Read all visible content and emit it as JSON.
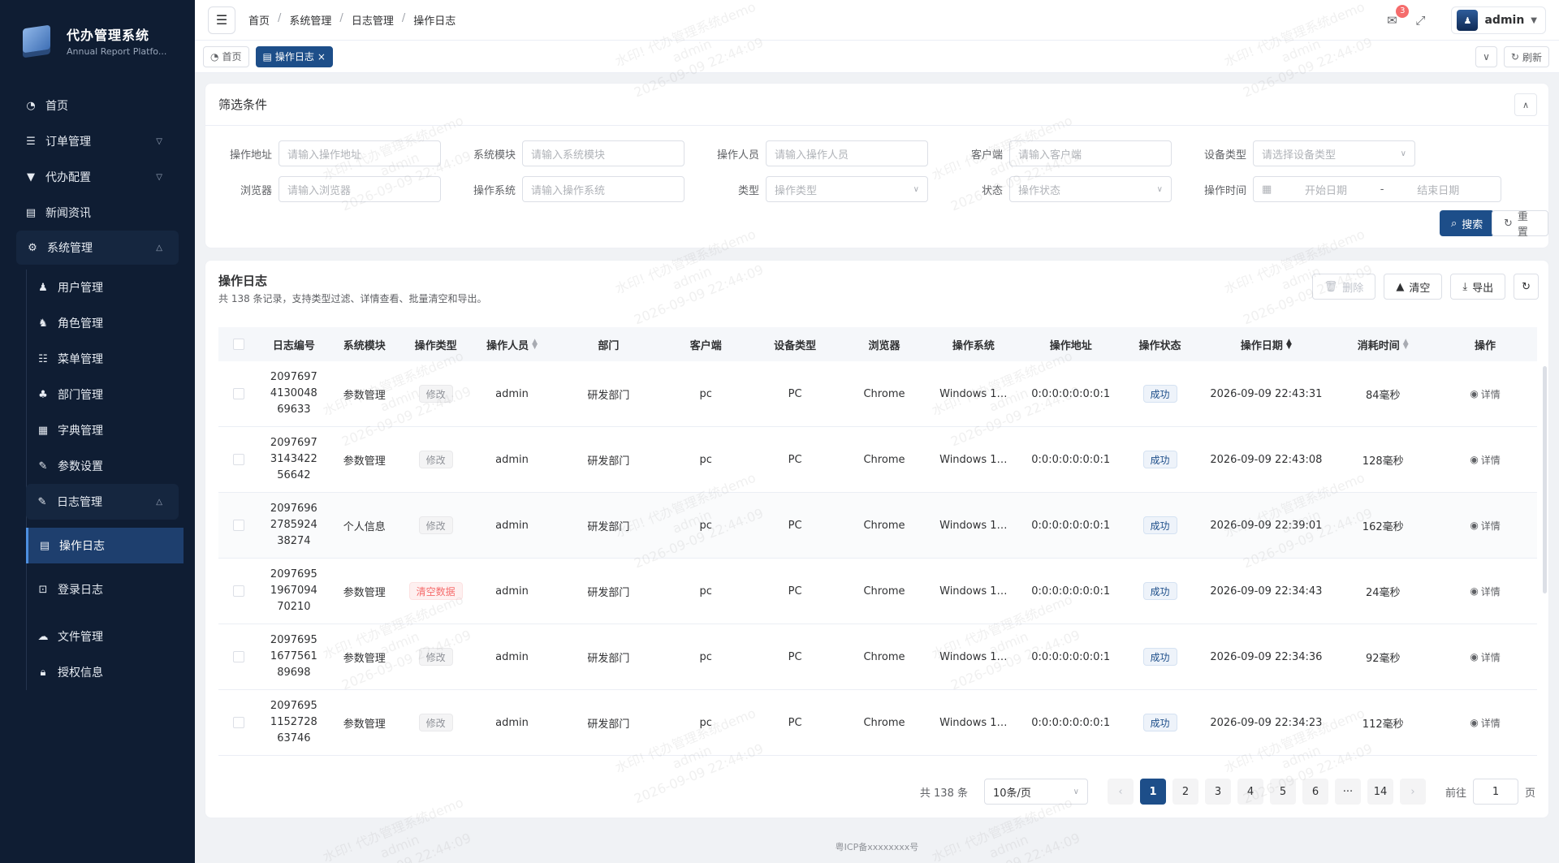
{
  "app": {
    "title": "代办管理系统",
    "subtitle": "Annual Report Platfo..."
  },
  "sidebar": {
    "items": [
      {
        "label": "首页"
      },
      {
        "label": "订单管理"
      },
      {
        "label": "代办配置"
      },
      {
        "label": "新闻资讯"
      },
      {
        "label": "系统管理"
      }
    ],
    "system_children": [
      {
        "label": "用户管理"
      },
      {
        "label": "角色管理"
      },
      {
        "label": "菜单管理"
      },
      {
        "label": "部门管理"
      },
      {
        "label": "字典管理"
      },
      {
        "label": "参数设置"
      },
      {
        "label": "日志管理"
      }
    ],
    "log_children": [
      {
        "label": "操作日志"
      },
      {
        "label": "登录日志"
      }
    ],
    "tail_children": [
      {
        "label": "文件管理"
      },
      {
        "label": "授权信息"
      }
    ]
  },
  "header": {
    "breadcrumb": [
      "首页",
      "系统管理",
      "日志管理",
      "操作日志"
    ],
    "breadcrumb_sep": "/",
    "notification_count": "3",
    "user_name": "admin"
  },
  "tags": {
    "home": "首页",
    "current": "操作日志",
    "refresh": "刷新"
  },
  "filter": {
    "title": "筛选条件",
    "fields": {
      "address": {
        "label": "操作地址",
        "placeholder": "请输入操作地址"
      },
      "module": {
        "label": "系统模块",
        "placeholder": "请输入系统模块"
      },
      "operator": {
        "label": "操作人员",
        "placeholder": "请输入操作人员"
      },
      "client": {
        "label": "客户端",
        "placeholder": "请输入客户端"
      },
      "device": {
        "label": "设备类型",
        "placeholder": "请选择设备类型"
      },
      "browser": {
        "label": "浏览器",
        "placeholder": "请输入浏览器"
      },
      "os": {
        "label": "操作系统",
        "placeholder": "请输入操作系统"
      },
      "type": {
        "label": "类型",
        "placeholder": "操作类型"
      },
      "status": {
        "label": "状态",
        "placeholder": "操作状态"
      },
      "time": {
        "label": "操作时间",
        "start": "开始日期",
        "sep": "-",
        "end": "结束日期"
      }
    },
    "search_label": "搜索",
    "reset_label": "重置"
  },
  "logs": {
    "title": "操作日志",
    "description": "共 138 条记录，支持类型过滤、详情查看、批量清空和导出。",
    "actions": {
      "delete": "删除",
      "clear": "清空",
      "export": "导出"
    },
    "columns": [
      "日志编号",
      "系统模块",
      "操作类型",
      "操作人员",
      "部门",
      "客户端",
      "设备类型",
      "浏览器",
      "操作系统",
      "操作地址",
      "操作状态",
      "操作日期",
      "消耗时间",
      "操作"
    ],
    "rows": [
      {
        "id": "2097697413004869633",
        "module": "参数管理",
        "type": "修改",
        "type_style": "info",
        "operator": "admin",
        "dept": "研发部门",
        "client": "pc",
        "device": "PC",
        "browser": "Chrome",
        "os": "Windows 1…",
        "address": "0:0:0:0:0:0:0:1",
        "status": "成功",
        "date": "2026-09-09 22:43:31",
        "cost": "84毫秒",
        "op": "详情"
      },
      {
        "id": "2097697314342256642",
        "module": "参数管理",
        "type": "修改",
        "type_style": "info",
        "operator": "admin",
        "dept": "研发部门",
        "client": "pc",
        "device": "PC",
        "browser": "Chrome",
        "os": "Windows 1…",
        "address": "0:0:0:0:0:0:0:1",
        "status": "成功",
        "date": "2026-09-09 22:43:08",
        "cost": "128毫秒",
        "op": "详情"
      },
      {
        "id": "2097696278592438274",
        "module": "个人信息",
        "type": "修改",
        "type_style": "info",
        "operator": "admin",
        "dept": "研发部门",
        "client": "pc",
        "device": "PC",
        "browser": "Chrome",
        "os": "Windows 1…",
        "address": "0:0:0:0:0:0:0:1",
        "status": "成功",
        "date": "2026-09-09 22:39:01",
        "cost": "162毫秒",
        "op": "详情"
      },
      {
        "id": "2097695196709470210",
        "module": "参数管理",
        "type": "清空数据",
        "type_style": "danger",
        "operator": "admin",
        "dept": "研发部门",
        "client": "pc",
        "device": "PC",
        "browser": "Chrome",
        "os": "Windows 1…",
        "address": "0:0:0:0:0:0:0:1",
        "status": "成功",
        "date": "2026-09-09 22:34:43",
        "cost": "24毫秒",
        "op": "详情"
      },
      {
        "id": "2097695167756189698",
        "module": "参数管理",
        "type": "修改",
        "type_style": "info",
        "operator": "admin",
        "dept": "研发部门",
        "client": "pc",
        "device": "PC",
        "browser": "Chrome",
        "os": "Windows 1…",
        "address": "0:0:0:0:0:0:0:1",
        "status": "成功",
        "date": "2026-09-09 22:34:36",
        "cost": "92毫秒",
        "op": "详情"
      },
      {
        "id": "2097695115272863746",
        "module": "参数管理",
        "type": "修改",
        "type_style": "info",
        "operator": "admin",
        "dept": "研发部门",
        "client": "pc",
        "device": "PC",
        "browser": "Chrome",
        "os": "Windows 1…",
        "address": "0:0:0:0:0:0:0:1",
        "status": "成功",
        "date": "2026-09-09 22:34:23",
        "cost": "112毫秒",
        "op": "详情"
      }
    ]
  },
  "pagination": {
    "total": "共 138 条",
    "page_size": "10条/页",
    "pages": [
      "1",
      "2",
      "3",
      "4",
      "5",
      "6",
      "···",
      "14"
    ],
    "current": "1",
    "goto_prefix": "前往",
    "goto_value": "1",
    "goto_suffix": "页"
  },
  "footer": {
    "icp": "粤ICP备xxxxxxxx号"
  },
  "watermark": {
    "line1": "水印! 代办管理系统demo",
    "line2": "admin",
    "line3": "2026-09-09 22:44:09"
  }
}
